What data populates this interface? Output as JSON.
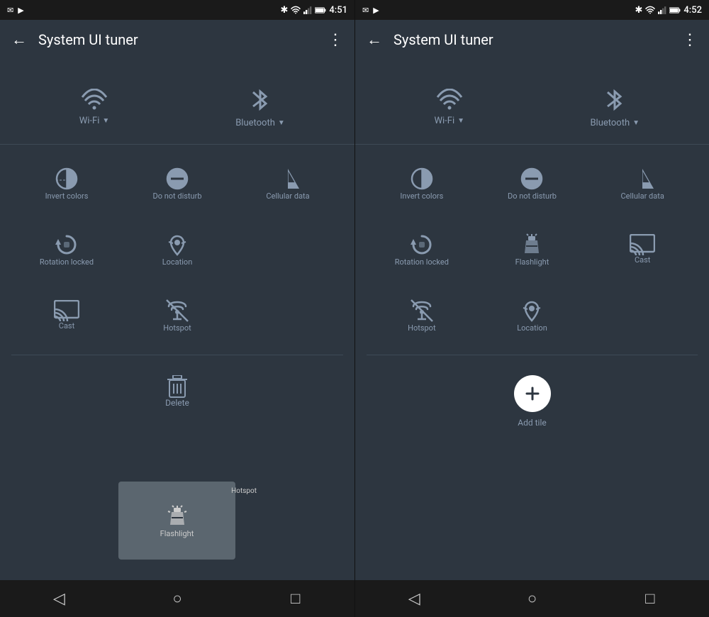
{
  "left_panel": {
    "status_bar": {
      "time": "4:51",
      "icons": [
        "gmail",
        "google-play",
        "bluetooth",
        "wifi",
        "signal",
        "battery"
      ]
    },
    "app_bar": {
      "title": "System UI tuner",
      "back_label": "←",
      "more_label": "⋮"
    },
    "wifi_label": "Wi-Fi",
    "bluetooth_label": "Bluetooth",
    "tiles": [
      {
        "id": "invert-colors",
        "label": "Invert colors"
      },
      {
        "id": "do-not-disturb",
        "label": "Do not disturb"
      },
      {
        "id": "cellular-data",
        "label": "Cellular data"
      },
      {
        "id": "rotation-locked",
        "label": "Rotation locked"
      },
      {
        "id": "flashlight",
        "label": "Flashlight"
      },
      {
        "id": "location",
        "label": "Location"
      },
      {
        "id": "cast",
        "label": "Cast"
      },
      {
        "id": "hotspot",
        "label": "Hotspot"
      }
    ],
    "drag_ghost_labels": [
      "Flashlight",
      "Hotspot"
    ],
    "bottom_action": {
      "icon": "delete",
      "label": "Delete"
    },
    "nav": {
      "back": "◁",
      "home": "○",
      "recents": "□"
    }
  },
  "right_panel": {
    "status_bar": {
      "time": "4:52",
      "icons": [
        "gmail",
        "google-play",
        "bluetooth",
        "wifi",
        "signal",
        "battery"
      ]
    },
    "app_bar": {
      "title": "System UI tuner",
      "back_label": "←",
      "more_label": "⋮"
    },
    "wifi_label": "Wi-Fi",
    "bluetooth_label": "Bluetooth",
    "tiles": [
      {
        "id": "invert-colors",
        "label": "Invert colors"
      },
      {
        "id": "do-not-disturb",
        "label": "Do not disturb"
      },
      {
        "id": "cellular-data",
        "label": "Cellular data"
      },
      {
        "id": "rotation-locked",
        "label": "Rotation locked"
      },
      {
        "id": "flashlight",
        "label": "Flashlight"
      },
      {
        "id": "cast",
        "label": "Cast"
      },
      {
        "id": "hotspot",
        "label": "Hotspot"
      },
      {
        "id": "location",
        "label": "Location"
      }
    ],
    "bottom_action": {
      "icon": "add",
      "label": "Add tile"
    },
    "nav": {
      "back": "◁",
      "home": "○",
      "recents": "□"
    }
  }
}
